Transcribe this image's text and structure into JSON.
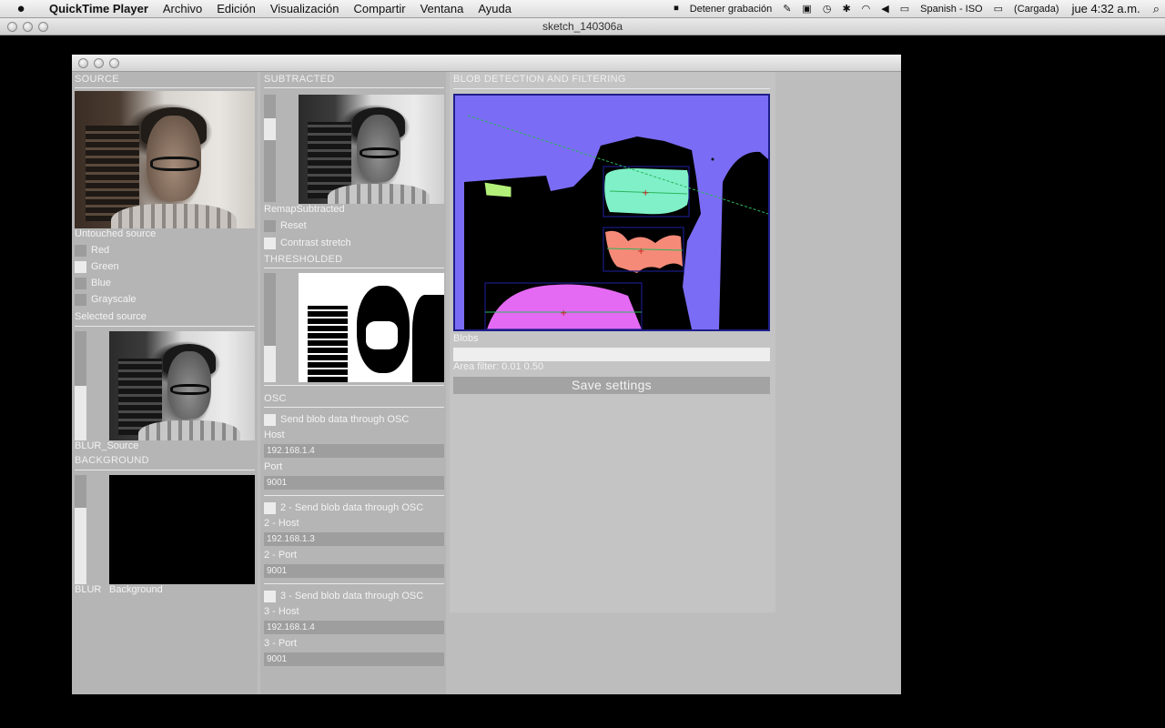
{
  "menubar": {
    "app_name": "QuickTime Player",
    "menus": [
      "Archivo",
      "Edición",
      "Visualización",
      "Compartir",
      "Ventana",
      "Ayuda"
    ],
    "recording": "Detener grabación",
    "input_source": "Spanish - ISO",
    "battery": "(Cargada)",
    "clock": "jue 4:32 a.m."
  },
  "qt_window": {
    "title": "sketch_140306a"
  },
  "source": {
    "header": "SOURCE",
    "untouched_label": "Untouched source",
    "channels": [
      {
        "label": "Red",
        "checked": false
      },
      {
        "label": "Green",
        "checked": true
      },
      {
        "label": "Blue",
        "checked": false
      },
      {
        "label": "Grayscale",
        "checked": false
      }
    ],
    "selected_label": "Selected source",
    "blur_label": "BLUR_Source",
    "blur_level": 0.5
  },
  "background": {
    "header": "BACKGROUND",
    "blur_label": "BLUR",
    "bg_label": "Background",
    "blur_level": 0.7
  },
  "subtracted": {
    "header": "SUBTRACTED",
    "remap_label": "RemapSubtracted",
    "reset_label": "Reset",
    "contrast_label": "Contrast stretch",
    "remap_level": 0.25
  },
  "thresholded": {
    "header": "THRESHOLDED",
    "level": 0.33
  },
  "osc": {
    "header": "OSC",
    "groups": [
      {
        "send_label": "Send blob data through OSC",
        "host_label": "Host",
        "host": "192.168.1.4",
        "port_label": "Port",
        "port": "9001"
      },
      {
        "send_label": "2 - Send blob data through OSC",
        "host_label": "2 - Host",
        "host": "192.168.1.3",
        "port_label": "2 - Port",
        "port": "9001"
      },
      {
        "send_label": "3 - Send blob data through OSC",
        "host_label": "3 - Host",
        "host": "192.168.1.4",
        "port_label": "3 - Port",
        "port": "9001"
      }
    ]
  },
  "blobs": {
    "header": "BLOB DETECTION AND FILTERING",
    "blobs_label": "Blobs",
    "area_filter_label": "Area filter: 0.01 0.50",
    "save_label": "Save settings",
    "colors": {
      "background": "#7b6cf5",
      "mask": "#000000",
      "blob1": "#7ff0c8",
      "blob2": "#f58a78",
      "blob3": "#e46af3",
      "blob4": "#b3f07a"
    }
  }
}
